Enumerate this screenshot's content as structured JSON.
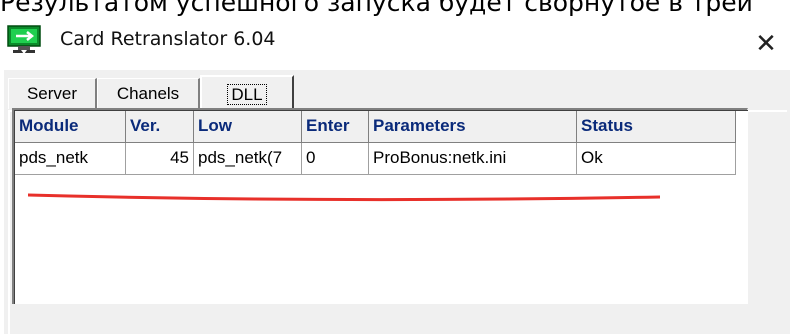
{
  "background_caption": "Результатом успешного запуска будет сворнутое в трей",
  "window": {
    "title": "Card Retranslator 6.04",
    "close_glyph": "✕"
  },
  "tabs": [
    {
      "label": "Server",
      "active": false
    },
    {
      "label": "Chanels",
      "active": false
    },
    {
      "label": "DLL",
      "active": true
    }
  ],
  "grid": {
    "columns": [
      "Module",
      "Ver.",
      "Low",
      "Enter",
      "Parameters",
      "Status"
    ],
    "rows": [
      [
        "pds_netk",
        "45",
        "pds_netk(7",
        "0",
        "ProBonus:netk.ini",
        "Ok"
      ]
    ]
  },
  "colors": {
    "header_text": "#0a2a7a",
    "underline_annotation": "#e8302a"
  },
  "icons": {
    "app": "monitor-with-green-arrow-icon",
    "close": "close-icon"
  }
}
